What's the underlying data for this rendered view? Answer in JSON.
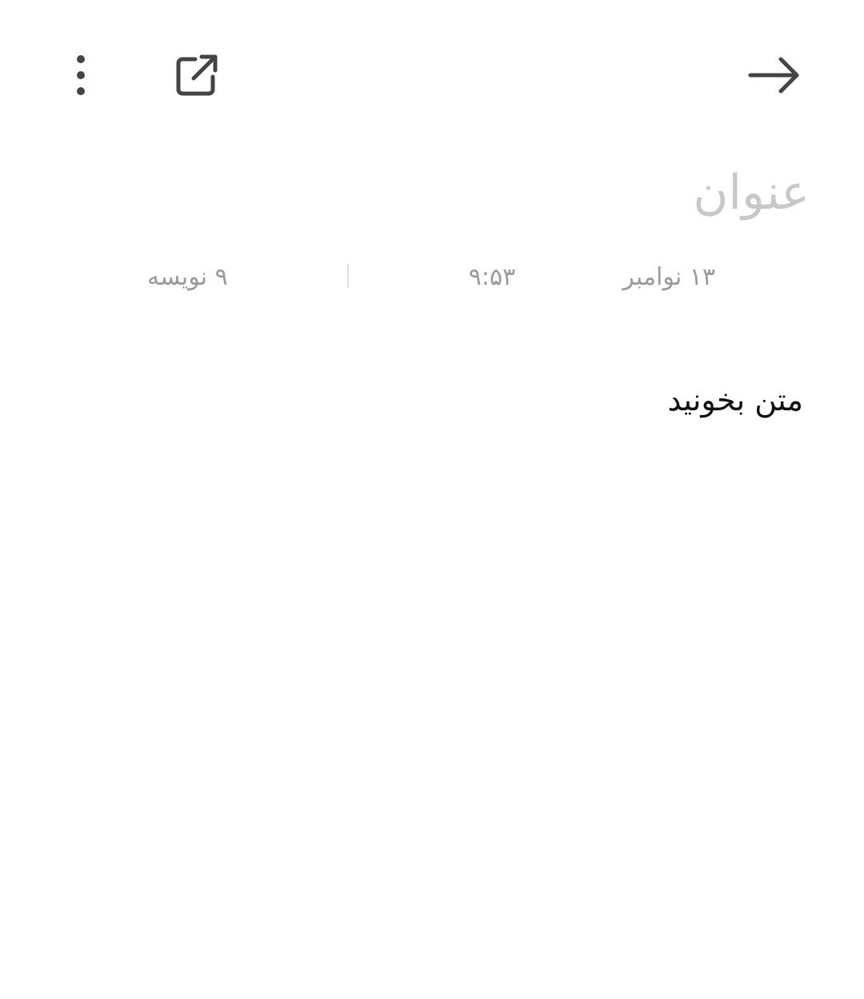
{
  "toolbar": {
    "more_icon": "more-vert-icon",
    "open_icon": "open-external-icon",
    "back_icon": "arrow-right-icon"
  },
  "note": {
    "title_placeholder": "عنوان",
    "date": "۱۳ نوامبر",
    "time": "۹:۵۳",
    "word_count": "۹ نویسه",
    "body": "متن بخونید"
  },
  "colors": {
    "icon": "#444444",
    "title_placeholder": "#c8c8c8",
    "meta": "#9a9a9a",
    "body": "#111111"
  }
}
